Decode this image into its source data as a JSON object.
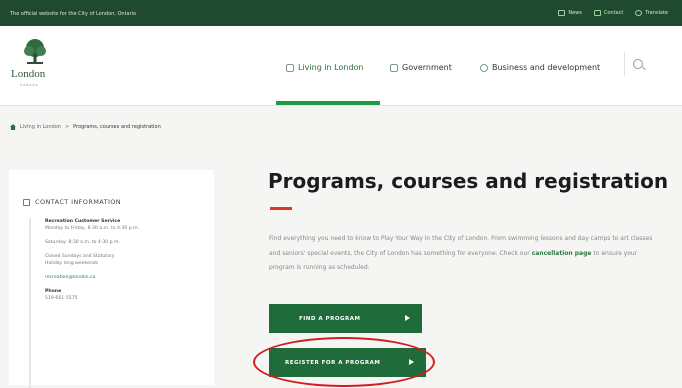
{
  "topbar": {
    "text": "The official website for the City of London, Ontario",
    "links": [
      "News",
      "Contact",
      "Translate"
    ]
  },
  "logo": {
    "name": "London",
    "sub": "CANADA"
  },
  "nav": {
    "items": [
      "Living in London",
      "Government",
      "Business and development"
    ]
  },
  "breadcrumb": {
    "items": [
      "Living in London",
      ">",
      "Programs, courses and registration"
    ]
  },
  "sidebar": {
    "title": "CONTACT INFORMATION",
    "service": "Recreation Customer Service",
    "hours1": "Monday to Friday, 8:30 a.m. to 4:30 p.m.",
    "hours2": "Saturday: 8:30 a.m. to 4:30 p.m.",
    "closed1": "Closed Sundays and Statutory",
    "closed2": "Holiday long weekends",
    "email": "recreation@london.ca",
    "phone_label": "Phone",
    "phone": "519-661-5575"
  },
  "main": {
    "title": "Programs, courses and registration",
    "intro_a": "Find everything you need to know to Play Your Way in the City of London. From swimming lessons and day camps to art classes and seniors' special events, the City of London has something for everyone. Check our",
    "intro_link": "cancellation page",
    "intro_b": "to ensure your program is running as scheduled.",
    "btn_find": "FIND A PROGRAM",
    "btn_register": "REGISTER FOR A PROGRAM"
  },
  "colors": {
    "primary": "#1f6b3a",
    "accent": "#d9392b",
    "header_bg": "#1f4a2f"
  }
}
